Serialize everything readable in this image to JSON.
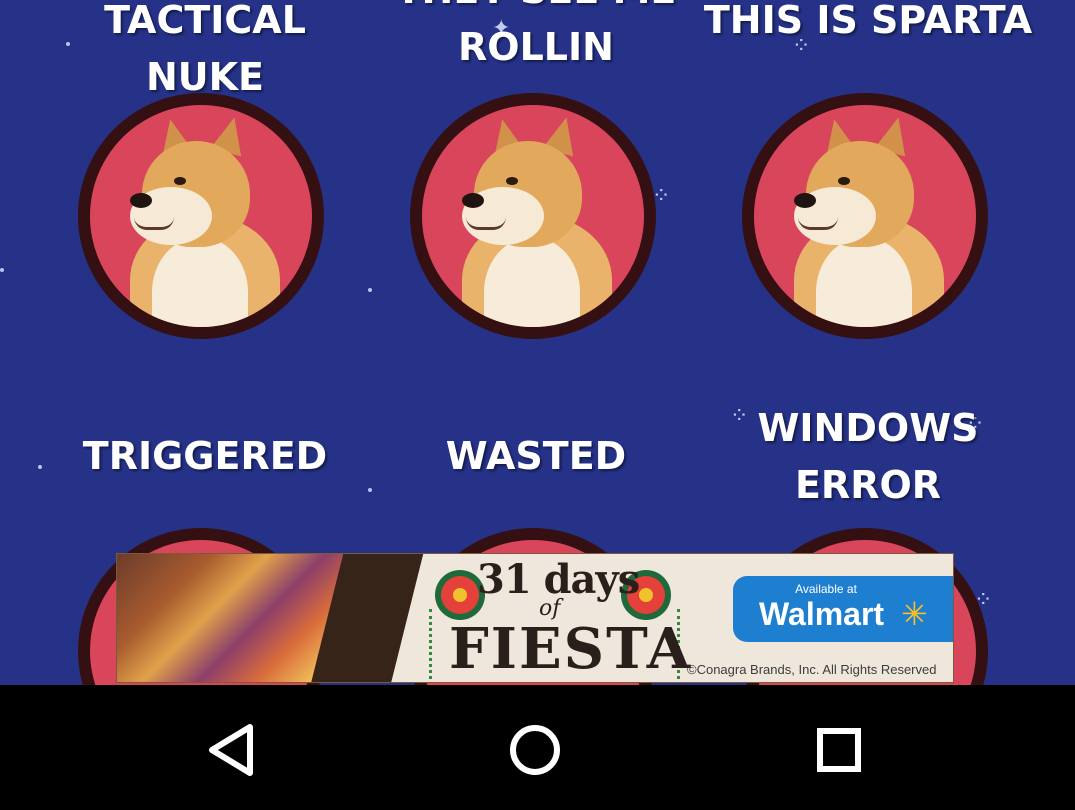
{
  "buttons": [
    {
      "label": "TACTICAL NUKE"
    },
    {
      "label": "THEY SEE ME\nROLLIN"
    },
    {
      "label": "THIS IS SPARTA"
    },
    {
      "label": "TRIGGERED"
    },
    {
      "label": "WASTED"
    },
    {
      "label": "WINDOWS\nERROR"
    }
  ],
  "ad": {
    "line1": "31 days",
    "line2": "of",
    "line3": "FIESTA",
    "retailer_prefix": "Available at",
    "retailer": "Walmart",
    "copyright": "©Conagra Brands, Inc. All Rights Reserved"
  },
  "navbar": {
    "back_icon": "back-triangle-icon",
    "home_icon": "home-circle-icon",
    "recents_icon": "recents-square-icon"
  },
  "colors": {
    "background": "#253288",
    "button_fill": "#d9455b",
    "button_ring": "#341013",
    "walmart_blue": "#1e7fd1",
    "walmart_spark": "#ffc220"
  }
}
